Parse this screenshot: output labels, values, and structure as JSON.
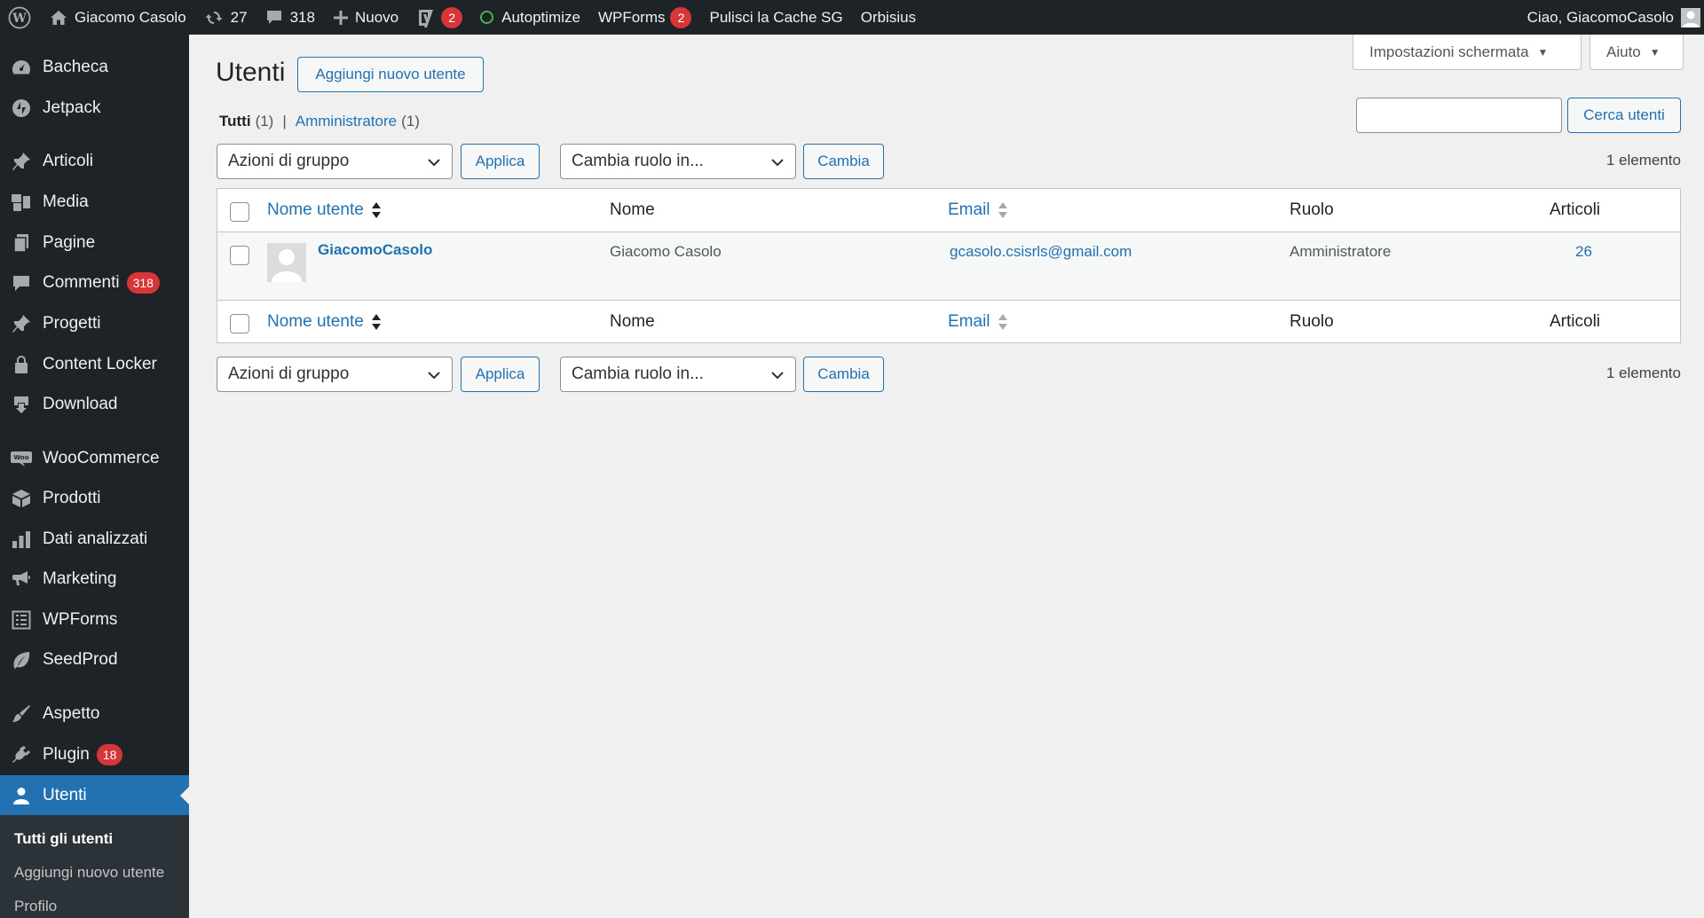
{
  "adminbar": {
    "site_name": "Giacomo Casolo",
    "updates_count": "27",
    "comments_count": "318",
    "new_label": "Nuovo",
    "yoast_badge": "2",
    "autoptimize_label": "Autoptimize",
    "wpforms_label": "WPForms",
    "wpforms_badge": "2",
    "cache_label": "Pulisci la Cache SG",
    "orbisius_label": "Orbisius",
    "greeting": "Ciao, GiacomoCasolo"
  },
  "sidebar": {
    "items": [
      {
        "label": "Bacheca",
        "icon": "dashboard-icon"
      },
      {
        "label": "Jetpack",
        "icon": "jetpack-icon"
      },
      {
        "label": "Articoli",
        "icon": "pin-icon"
      },
      {
        "label": "Media",
        "icon": "media-icon"
      },
      {
        "label": "Pagine",
        "icon": "page-icon"
      },
      {
        "label": "Commenti",
        "icon": "comment-icon",
        "badge": "318"
      },
      {
        "label": "Progetti",
        "icon": "pin-icon"
      },
      {
        "label": "Content Locker",
        "icon": "lock-icon"
      },
      {
        "label": "Download",
        "icon": "download-icon"
      },
      {
        "label": "WooCommerce",
        "icon": "woocommerce-icon"
      },
      {
        "label": "Prodotti",
        "icon": "box-icon"
      },
      {
        "label": "Dati analizzati",
        "icon": "bar-chart-icon"
      },
      {
        "label": "Marketing",
        "icon": "megaphone-icon"
      },
      {
        "label": "WPForms",
        "icon": "form-icon"
      },
      {
        "label": "SeedProd",
        "icon": "leaf-icon"
      },
      {
        "label": "Aspetto",
        "icon": "brush-icon"
      },
      {
        "label": "Plugin",
        "icon": "plugin-icon",
        "badge": "18"
      },
      {
        "label": "Utenti",
        "icon": "user-icon"
      }
    ],
    "submenu": [
      "Tutti gli utenti",
      "Aggiungi nuovo utente",
      "Profilo"
    ]
  },
  "screen_options": {
    "label": "Impostazioni schermata",
    "help_label": "Aiuto"
  },
  "page": {
    "title": "Utenti",
    "add_new_label": "Aggiungi nuovo utente",
    "filters": {
      "all_label": "Tutti",
      "all_count": "(1)",
      "admin_label": "Amministratore",
      "admin_count": "(1)"
    },
    "search": {
      "value": "",
      "button_label": "Cerca utenti"
    },
    "bulk_actions_label": "Azioni di gruppo",
    "apply_label": "Applica",
    "change_role_label": "Cambia ruolo in...",
    "change_label": "Cambia",
    "items_count": "1 elemento"
  },
  "table": {
    "columns": {
      "username": "Nome utente",
      "name": "Nome",
      "email": "Email",
      "role": "Ruolo",
      "posts": "Articoli"
    },
    "rows": [
      {
        "username": "GiacomoCasolo",
        "name": "Giacomo Casolo",
        "email": "gcasolo.csisrls@gmail.com",
        "role": "Amministratore",
        "posts": "26"
      }
    ]
  }
}
